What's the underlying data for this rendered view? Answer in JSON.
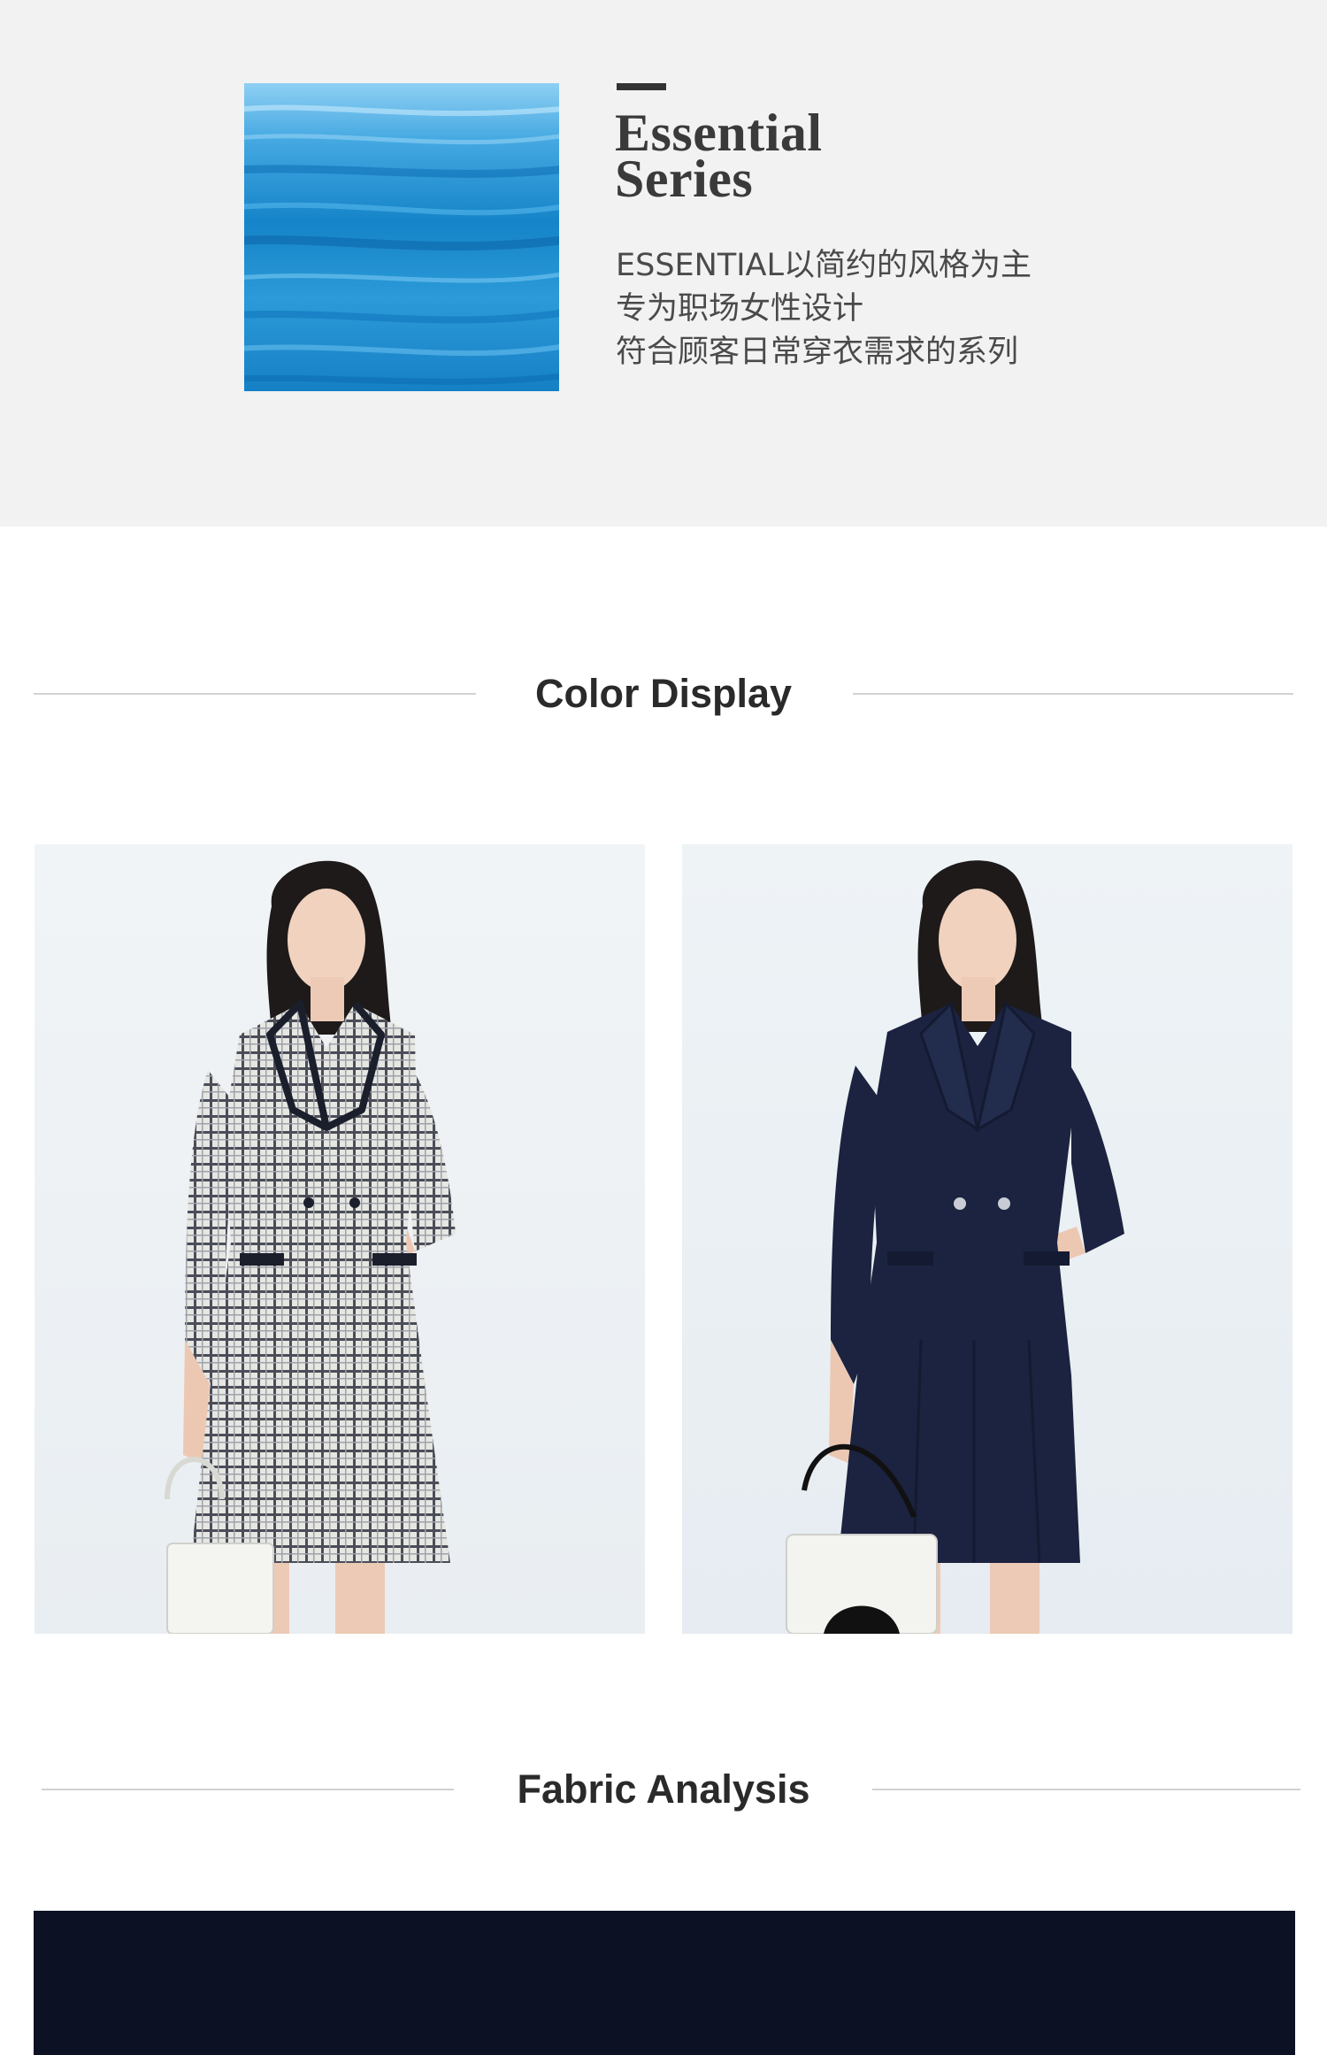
{
  "series": {
    "title_line1": "Essential",
    "title_line2": "Series",
    "description": [
      "ESSENTIAL以简约的风格为主",
      "专为职场女性设计",
      "符合顾客日常穿衣需求的系列"
    ],
    "swatch_color": "#1f8fd0"
  },
  "color_display": {
    "heading": "Color Display",
    "products": [
      {
        "variant": "plaid",
        "dress_color": "#d9d9d6",
        "trim_color": "#1b1f2c"
      },
      {
        "variant": "navy",
        "dress_color": "#1b2340",
        "trim_color": "#1b2340"
      }
    ]
  },
  "fabric_analysis": {
    "heading": "Fabric Analysis",
    "fabric_color": "#0c1124"
  },
  "colors": {
    "banner_bg": "#f2f2f2",
    "heading_text": "#2a2a2a",
    "rule": "#d2d2d2"
  }
}
